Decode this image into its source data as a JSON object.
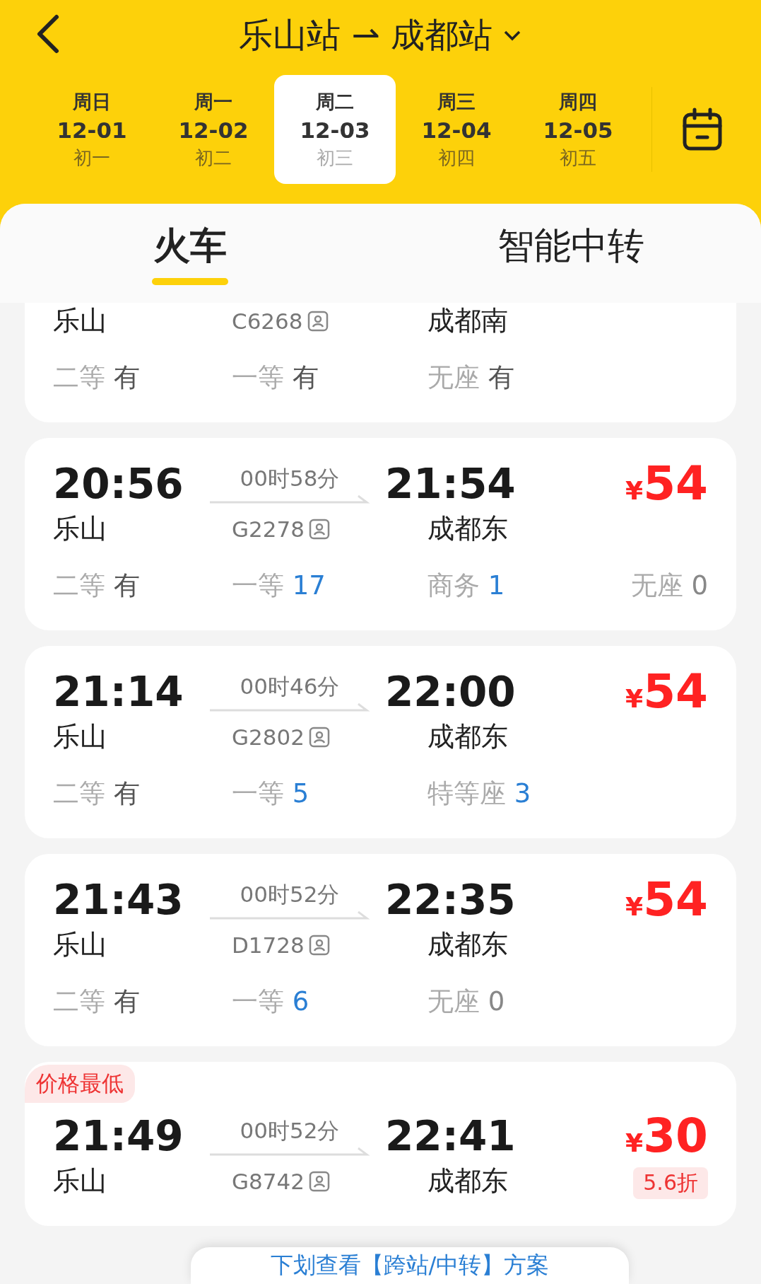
{
  "header": {
    "title_from": "乐山站",
    "title_to": "成都站"
  },
  "dates": [
    {
      "weekday": "周日",
      "date": "12-01",
      "lunar": "初一",
      "selected": false
    },
    {
      "weekday": "周一",
      "date": "12-02",
      "lunar": "初二",
      "selected": false
    },
    {
      "weekday": "周二",
      "date": "12-03",
      "lunar": "初三",
      "selected": true
    },
    {
      "weekday": "周三",
      "date": "12-04",
      "lunar": "初四",
      "selected": false
    },
    {
      "weekday": "周四",
      "date": "12-05",
      "lunar": "初五",
      "selected": false
    }
  ],
  "tabs": [
    {
      "label": "火车",
      "selected": true
    },
    {
      "label": "智能中转",
      "selected": false
    }
  ],
  "arrow": "⇀",
  "trains": [
    {
      "from": "乐山",
      "train_no": "C6268",
      "to": "成都南",
      "seats": [
        {
          "class": "二等",
          "avail": "有",
          "color": "#555555"
        },
        {
          "class": "一等",
          "avail": "有",
          "color": "#555555"
        },
        {
          "class": "无座",
          "avail": "有",
          "color": "#555555"
        }
      ]
    },
    {
      "depart": "20:56",
      "duration": "00时58分",
      "arrive": "21:54",
      "price": "54",
      "from": "乐山",
      "train_no": "G2278",
      "to": "成都东",
      "seats": [
        {
          "class": "二等",
          "avail": "有",
          "color": "#555555"
        },
        {
          "class": "一等",
          "avail": "17",
          "color": "#2a7fd4"
        },
        {
          "class": "商务",
          "avail": "1",
          "color": "#2a7fd4"
        },
        {
          "class": "无座",
          "avail": "0",
          "color": "#888888"
        }
      ]
    },
    {
      "depart": "21:14",
      "duration": "00时46分",
      "arrive": "22:00",
      "price": "54",
      "from": "乐山",
      "train_no": "G2802",
      "to": "成都东",
      "seats": [
        {
          "class": "二等",
          "avail": "有",
          "color": "#555555"
        },
        {
          "class": "一等",
          "avail": "5",
          "color": "#2a7fd4"
        },
        {
          "class": "特等座",
          "avail": "3",
          "color": "#2a7fd4"
        }
      ]
    },
    {
      "depart": "21:43",
      "duration": "00时52分",
      "arrive": "22:35",
      "price": "54",
      "from": "乐山",
      "train_no": "D1728",
      "to": "成都东",
      "seats": [
        {
          "class": "二等",
          "avail": "有",
          "color": "#555555"
        },
        {
          "class": "一等",
          "avail": "6",
          "color": "#2a7fd4"
        },
        {
          "class": "无座",
          "avail": "0",
          "color": "#888888"
        }
      ]
    },
    {
      "tag": "价格最低",
      "depart": "21:49",
      "duration": "00时52分",
      "arrive": "22:41",
      "price": "30",
      "discount": "5.6折",
      "from": "乐山",
      "train_no": "G8742",
      "to": "成都东"
    }
  ],
  "currency": "¥",
  "banner": "下划查看【跨站/中转】方案"
}
